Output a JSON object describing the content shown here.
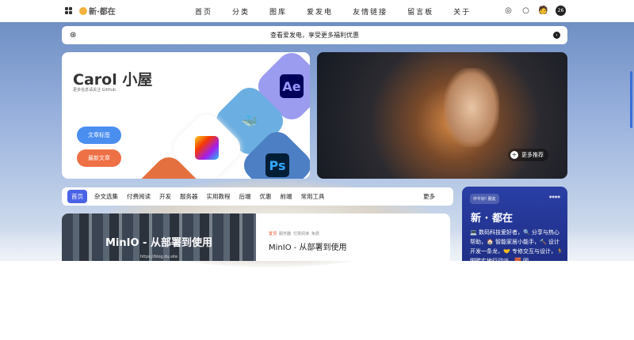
{
  "nav": {
    "logo": "新·都在",
    "menu": [
      "首页",
      "分类",
      "图库",
      "爱发电",
      "友情链接",
      "留言板",
      "关于"
    ],
    "avatar": "26"
  },
  "banner": {
    "text": "查看爱发电，享受更多福利优惠"
  },
  "hero": {
    "title": "Carol 小屋",
    "subtitle": "更多信息请关注 GitHub",
    "buttons": [
      "文章标签",
      "最新文章"
    ],
    "tiles": [
      "Ae",
      "Ps"
    ]
  },
  "feature": {
    "more_label": "更多推荐"
  },
  "categories": {
    "items": [
      "首页",
      "杂文选集",
      "付费阅读",
      "开发",
      "服务器",
      "实用教程",
      "后端",
      "优惠",
      "前端",
      "常用工具"
    ],
    "more": "更多"
  },
  "post": {
    "image_title": "MinIO - 从部署到使用",
    "image_url": "https://blog.du.site",
    "tags": [
      "置顶",
      "服务器",
      "付费阅读",
      "免费"
    ],
    "title": "MinIO - 从部署到使用"
  },
  "sidebar": {
    "greeting": "中午好! 朋友",
    "tag": "●●●●",
    "name": "新 · 都在",
    "bio": "💻 数码科技爱好者，🔍 分享与热心帮助，🏠 智能家居小能手，🔨 设计开发一条龙，🤝 专修交互与设计，🏃 脚踏实地行动派，🧱 团"
  },
  "colors": {
    "accent": "#4a63e6",
    "sidebar": "#2a3fa6",
    "tag_btn": "#4a8ef0",
    "new_btn": "#ee7045"
  }
}
